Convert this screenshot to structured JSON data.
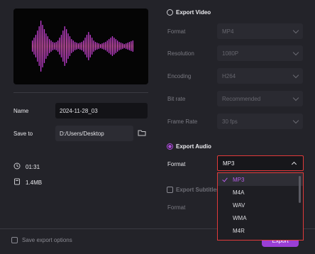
{
  "colors": {
    "accent": "#b14ce0",
    "highlight_border": "#e03a3a",
    "panel_bg": "#232329"
  },
  "preview": {
    "icon": "audio-waveform"
  },
  "info": {
    "name_label": "Name",
    "name_value": "2024-11-28_03",
    "save_label": "Save to",
    "save_value": "D:/Users/Desktop",
    "duration": "01:31",
    "size": "1.4MB"
  },
  "video": {
    "title": "Export Video",
    "rows": [
      {
        "label": "Format",
        "value": "MP4"
      },
      {
        "label": "Resolution",
        "value": "1080P"
      },
      {
        "label": "Encoding",
        "value": "H264"
      },
      {
        "label": "Bit rate",
        "value": "Recommended"
      },
      {
        "label": "Frame Rate",
        "value": "30  fps"
      }
    ]
  },
  "audio": {
    "title": "Export Audio",
    "format_label": "Format",
    "format_value": "MP3",
    "options": [
      "MP3",
      "M4A",
      "WAV",
      "WMA",
      "M4R"
    ],
    "selected": "MP3"
  },
  "subtitles": {
    "title": "Export Subtitles",
    "format_label": "Format"
  },
  "footer": {
    "save_options": "Save export options",
    "export": "Export"
  }
}
